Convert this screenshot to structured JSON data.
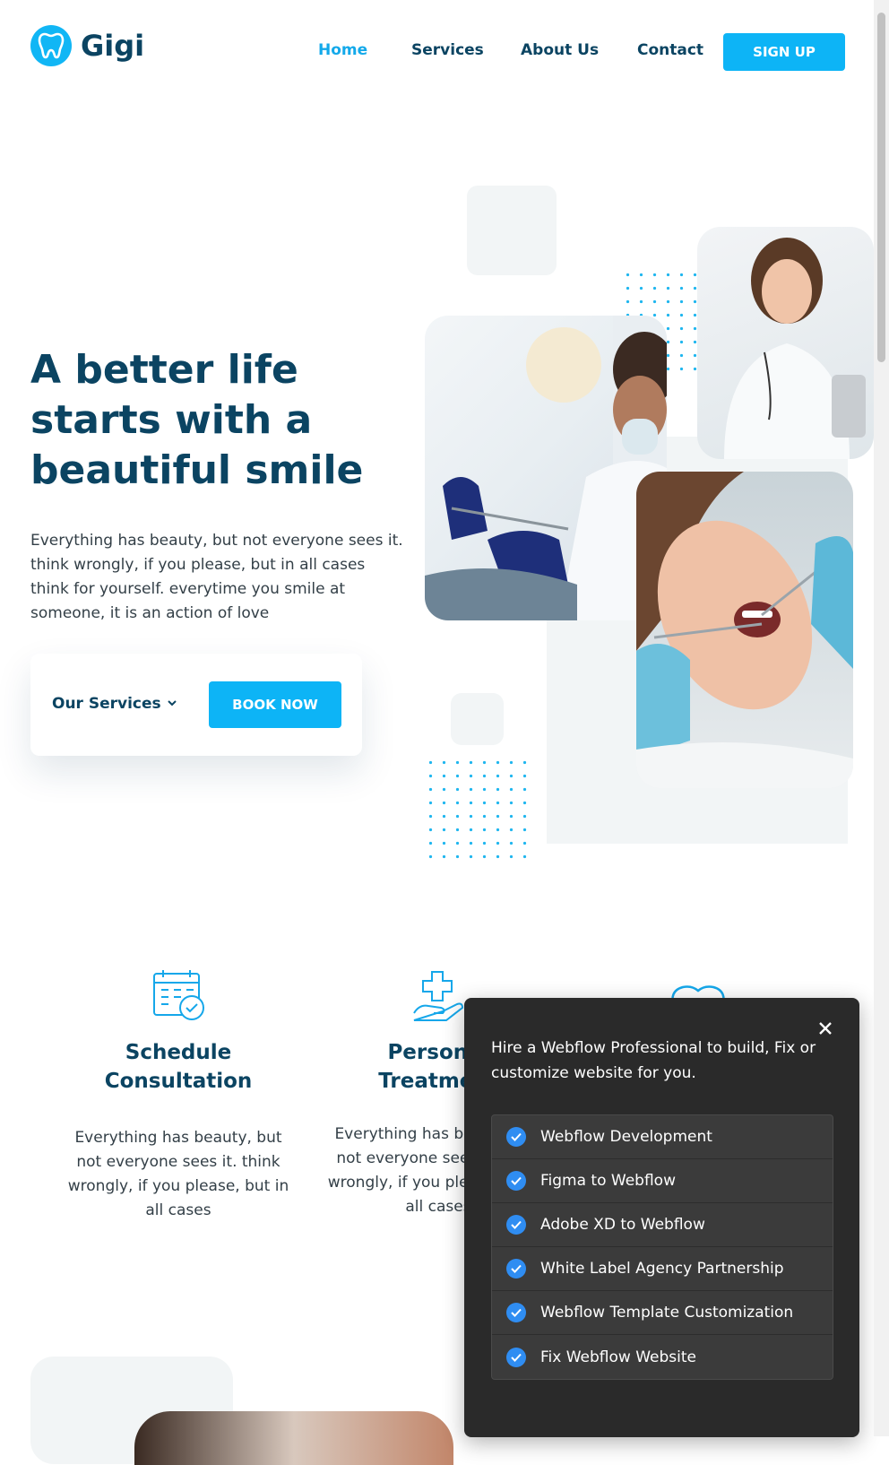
{
  "header": {
    "brand": "Gigi",
    "nav": [
      "Home",
      "Services",
      "About Us",
      "Contact"
    ],
    "active_nav": "Home",
    "signup": "SIGN UP"
  },
  "hero": {
    "title": "A better life starts with a beautiful smile",
    "text": "Everything has beauty, but not everyone sees it. think wrongly, if you please, but in all cases think for yourself. everytime you smile at someone, it is an action of love",
    "services_dropdown": "Our Services",
    "book_now": "BOOK NOW"
  },
  "features": [
    {
      "title": "Schedule Consultation",
      "text": "Everything has beauty, but not everyone sees it. think wrongly, if you please, but in all cases",
      "icon": "calendar-check-icon"
    },
    {
      "title": "Personal Treatment",
      "text": "Everything has beauty, but not everyone sees it. think wrongly, if you please, but in all cases",
      "icon": "hand-medical-cross-icon"
    },
    {
      "title": "",
      "text": "",
      "icon": "tooth-icon"
    }
  ],
  "popup": {
    "message": "Hire a Webflow Professional to build, Fix or customize website for you.",
    "items": [
      "Webflow Development",
      "Figma to Webflow",
      "Adobe XD to Webflow",
      "White Label Agency Partnership",
      "Webflow Template Customization",
      "Fix Webflow Website"
    ]
  },
  "colors": {
    "accent": "#0db4f6",
    "heading": "#0b4462",
    "popup_bg": "#2a2a2a",
    "check": "#2f8df2"
  }
}
